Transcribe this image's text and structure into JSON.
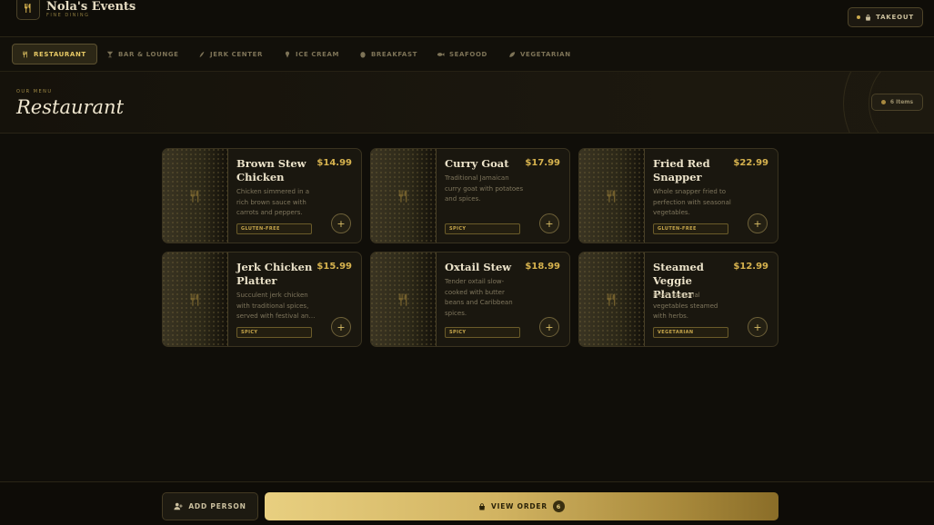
{
  "header": {
    "brand_name": "Nola's Events",
    "brand_subtitle": "FINE DINING",
    "takeout_label": "TAKEOUT"
  },
  "categories": [
    {
      "label": "RESTAURANT",
      "icon": "utensils-icon",
      "active": true
    },
    {
      "label": "BAR & LOUNGE",
      "icon": "cocktail-icon",
      "active": false
    },
    {
      "label": "JERK CENTER",
      "icon": "flame-icon",
      "active": false
    },
    {
      "label": "ICE CREAM",
      "icon": "ice-cream-icon",
      "active": false
    },
    {
      "label": "BREAKFAST",
      "icon": "egg-icon",
      "active": false
    },
    {
      "label": "SEAFOOD",
      "icon": "fish-icon",
      "active": false
    },
    {
      "label": "VEGETARIAN",
      "icon": "leaf-icon",
      "active": false
    }
  ],
  "section": {
    "eyebrow": "OUR MENU",
    "title": "Restaurant",
    "count_label": "6 Items"
  },
  "menu": [
    {
      "name": "Brown Stew Chicken",
      "price": "$14.99",
      "description": "Chicken simmered in a rich brown sauce with carrots and peppers.",
      "tag": "GLUTEN-FREE"
    },
    {
      "name": "Curry Goat",
      "price": "$17.99",
      "description": "Traditional Jamaican curry goat with potatoes and spices.",
      "tag": "SPICY"
    },
    {
      "name": "Fried Red Snapper",
      "price": "$22.99",
      "description": "Whole snapper fried to perfection with seasonal vegetables.",
      "tag": "GLUTEN-FREE"
    },
    {
      "name": "Jerk Chicken Platter",
      "price": "$15.99",
      "description": "Succulent jerk chicken with traditional spices, served with festival and plantains.",
      "tag": "SPICY"
    },
    {
      "name": "Oxtail Stew",
      "price": "$18.99",
      "description": "Tender oxtail slow-cooked with butter beans and Caribbean spices.",
      "tag": "SPICY"
    },
    {
      "name": "Steamed Veggie Platter",
      "price": "$12.99",
      "description": "Fresh seasonal vegetables steamed with herbs.",
      "tag": "VEGETARIAN"
    }
  ],
  "footer": {
    "add_person_label": "ADD PERSON",
    "view_order_label": "VIEW ORDER",
    "order_count": "6"
  },
  "colors": {
    "accent": "#d6b24e",
    "background": "#100e09",
    "card": "#1a170f"
  }
}
